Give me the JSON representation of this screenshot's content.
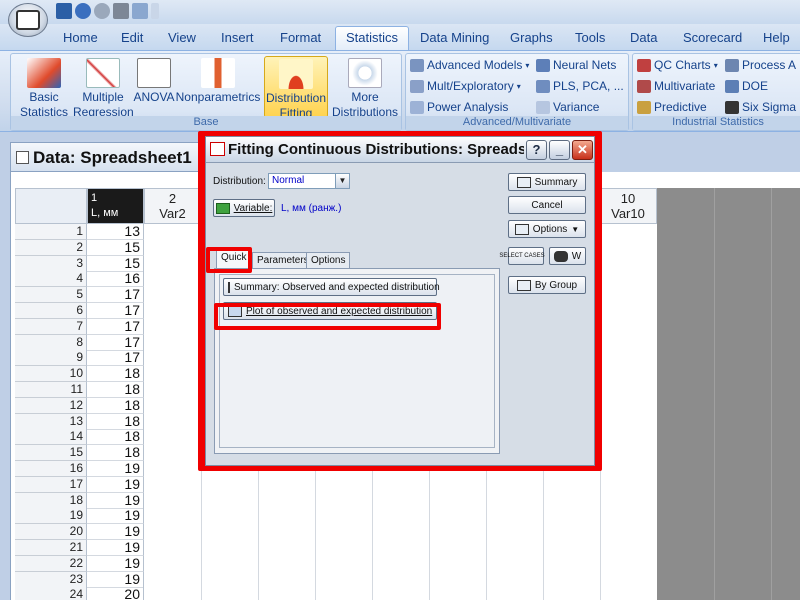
{
  "ribbon": {
    "tabs": [
      "Home",
      "Edit",
      "View",
      "Insert",
      "Format",
      "Statistics",
      "Data Mining",
      "Graphs",
      "Tools",
      "Data",
      "Scorecard",
      "Help"
    ],
    "active_tab": "Statistics",
    "base_buttons": [
      {
        "line1": "Basic",
        "line2": "Statistics"
      },
      {
        "line1": "Multiple",
        "line2": "Regression"
      },
      {
        "line1": "ANOVA",
        "line2": ""
      },
      {
        "line1": "Nonparametrics",
        "line2": ""
      },
      {
        "line1": "Distribution",
        "line2": "Fitting"
      },
      {
        "line1": "More",
        "line2": "Distributions"
      }
    ],
    "base_group_label": "Base",
    "advanced": {
      "items": [
        "Advanced Models",
        "Neural Nets",
        "Mult/Exploratory",
        "PLS, PCA, ...",
        "Power Analysis",
        "Variance"
      ],
      "group_label": "Advanced/Multivariate"
    },
    "industrial": {
      "items": [
        "QC Charts",
        "Process A",
        "Multivariate",
        "DOE",
        "Predictive",
        "Six Sigma"
      ],
      "group_label": "Industrial Statistics"
    }
  },
  "spreadsheet": {
    "title": "Data: Spreadsheet1",
    "col1_header_num": "1",
    "col1_header_name": "L, мм",
    "col2_header_num": "2",
    "col2_header_name": "Var2",
    "col10_header_num": "10",
    "col10_header_name": "Var10",
    "rows": [
      {
        "n": "1",
        "v": "13"
      },
      {
        "n": "2",
        "v": "15"
      },
      {
        "n": "3",
        "v": "15"
      },
      {
        "n": "4",
        "v": "16"
      },
      {
        "n": "5",
        "v": "17"
      },
      {
        "n": "6",
        "v": "17"
      },
      {
        "n": "7",
        "v": "17"
      },
      {
        "n": "8",
        "v": "17"
      },
      {
        "n": "9",
        "v": "17"
      },
      {
        "n": "10",
        "v": "18"
      },
      {
        "n": "11",
        "v": "18"
      },
      {
        "n": "12",
        "v": "18"
      },
      {
        "n": "13",
        "v": "18"
      },
      {
        "n": "14",
        "v": "18"
      },
      {
        "n": "15",
        "v": "18"
      },
      {
        "n": "16",
        "v": "19"
      },
      {
        "n": "17",
        "v": "19"
      },
      {
        "n": "18",
        "v": "19"
      },
      {
        "n": "19",
        "v": "19"
      },
      {
        "n": "20",
        "v": "19"
      },
      {
        "n": "21",
        "v": "19"
      },
      {
        "n": "22",
        "v": "19"
      },
      {
        "n": "23",
        "v": "19"
      },
      {
        "n": "24",
        "v": "20"
      }
    ]
  },
  "dialog": {
    "title": "Fitting Continuous Distributions: Spreadsheet1",
    "help_btn": "?",
    "min_btn": "_",
    "close_btn": "✕",
    "distribution_label": "Distribution:",
    "distribution_value": "Normal",
    "variable_button": "Variable:",
    "variable_value": "L, мм (ранж.)",
    "right_buttons": {
      "summary": "Summary",
      "cancel": "Cancel",
      "options": "Options",
      "select_cases": "SELECT CASES",
      "select_s": "S",
      "w": "W",
      "by_group": "By Group"
    },
    "tabs": [
      "Quick",
      "Parameters",
      "Options"
    ],
    "active_tab": "Quick",
    "quick": {
      "summary_btn": "Summary:  Observed and expected distribution",
      "plot_btn": "Plot of observed and expected distribution"
    }
  },
  "colors": {
    "highlight": "#f00000",
    "ribbon_text": "#15428b",
    "selected_header": "#1a1a1a"
  }
}
